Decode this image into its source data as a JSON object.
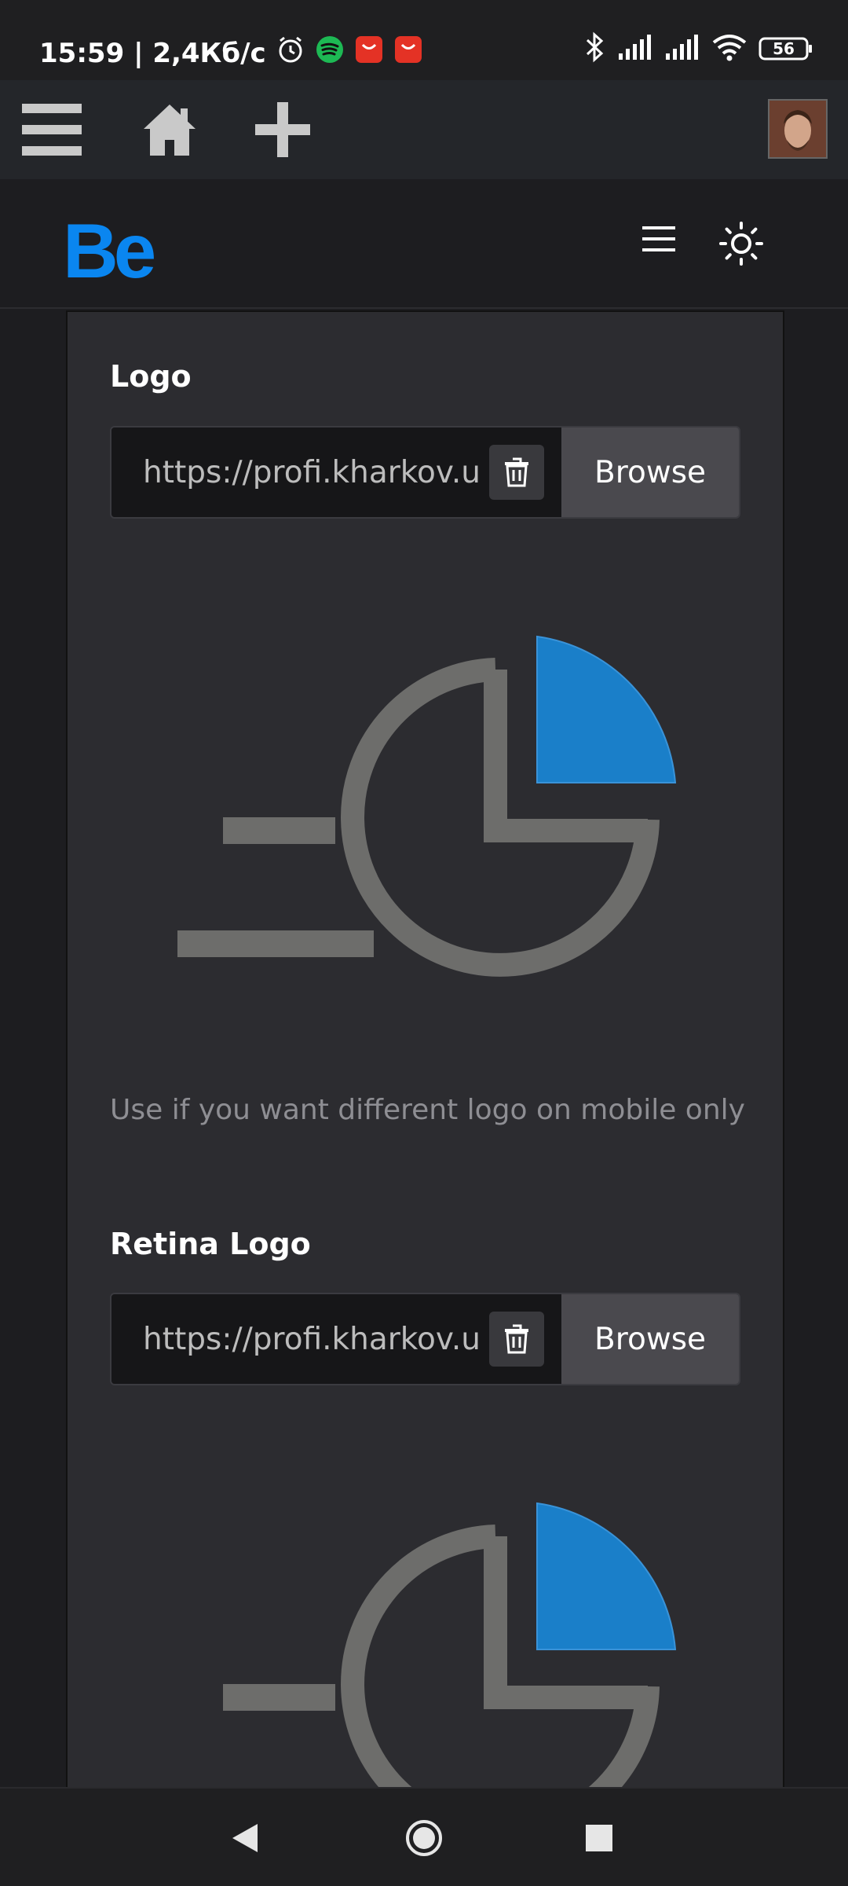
{
  "status_bar": {
    "time_speed": "15:59 | 2,4Кб/с",
    "battery": "56",
    "icons": [
      "alarm-icon",
      "spotify-icon",
      "aliexpress-icon",
      "aliexpress-icon",
      "bluetooth-icon",
      "signal-icon",
      "signal-icon",
      "wifi-icon",
      "battery-icon"
    ]
  },
  "admin_bar": {
    "items": [
      "menu-icon",
      "home-icon",
      "add-icon"
    ],
    "avatar": "user-avatar"
  },
  "header": {
    "logo": "Be",
    "brand_color": "#0a86f0",
    "menu_icon": "hamburger-icon",
    "theme_icon": "sun-icon"
  },
  "fields": [
    {
      "label": "Logo",
      "value": "https://profi.kharkov.u",
      "browse_label": "Browse",
      "help": "Use if you want different logo on mobile only"
    },
    {
      "label": "Retina Logo",
      "value": "https://profi.kharkov.u",
      "browse_label": "Browse"
    }
  ],
  "nav_bar": {
    "items": [
      "back-icon",
      "home-circle-icon",
      "recents-icon"
    ]
  },
  "colors": {
    "accent_blue": "#1a7fc9",
    "logo_gray": "#6d6d6b"
  }
}
